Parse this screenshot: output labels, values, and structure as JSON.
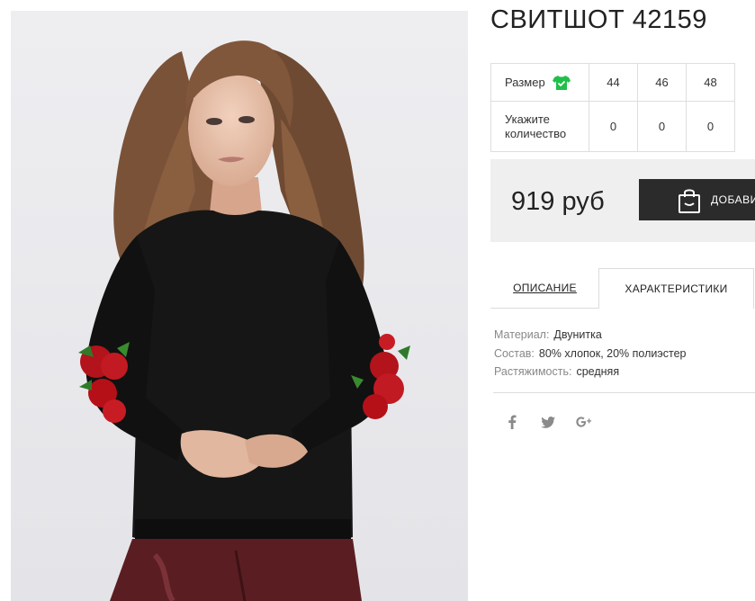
{
  "product": {
    "title": "СВИТШОТ 42159"
  },
  "sizes": {
    "size_label": "Размер",
    "size_icon": "t-shirt-check-icon",
    "size_icon_color": "#1fbf4a",
    "quantity_label": "Укажите количество",
    "items": [
      {
        "size": "44",
        "qty": "0"
      },
      {
        "size": "46",
        "qty": "0"
      },
      {
        "size": "48",
        "qty": "0"
      }
    ]
  },
  "purchase": {
    "price": "919 руб",
    "add_button_label": "ДОБАВИТЬ В КОРЗИНУ",
    "add_button_icon": "shopping-bag-icon"
  },
  "tabs": [
    {
      "label": "ОПИСАНИЕ",
      "active": false
    },
    {
      "label": "ХАРАКТЕРИСТИКИ",
      "active": true
    }
  ],
  "characteristics": [
    {
      "key": "Материал:",
      "value": "Двунитка"
    },
    {
      "key": "Состав:",
      "value": "80% хлопок, 20% полиэстер"
    },
    {
      "key": "Растяжимость:",
      "value": "средняя"
    }
  ],
  "social": [
    "facebook-icon",
    "twitter-icon",
    "google-plus-icon"
  ],
  "colors": {
    "accent_dark": "#2b2b2b",
    "price_bg": "#efefef"
  }
}
